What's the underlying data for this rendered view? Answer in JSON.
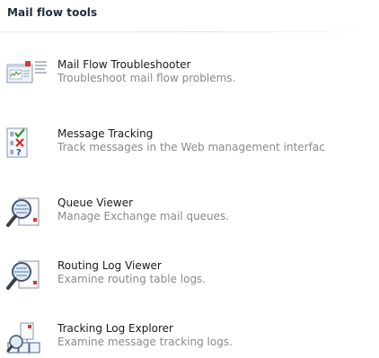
{
  "section": {
    "title": "Mail flow tools"
  },
  "tools": [
    {
      "name": "Mail Flow Troubleshooter",
      "description": "Troubleshoot mail flow problems.",
      "icon": "troubleshooter-icon"
    },
    {
      "name": "Message Tracking",
      "description": "Track messages in the Web management interfac",
      "icon": "checklist-icon"
    },
    {
      "name": "Queue Viewer",
      "description": "Manage Exchange mail queues.",
      "icon": "magnifier-document-icon"
    },
    {
      "name": "Routing Log Viewer",
      "description": "Examine routing table logs.",
      "icon": "magnifier-document-icon"
    },
    {
      "name": "Tracking Log Explorer",
      "description": "Examine message tracking logs.",
      "icon": "log-explorer-icon"
    }
  ],
  "colors": {
    "title_text": "#1f2a3a",
    "item_text": "#1a1a1a",
    "description_text": "#8a8a8a",
    "rule": "#d9e6f3"
  }
}
